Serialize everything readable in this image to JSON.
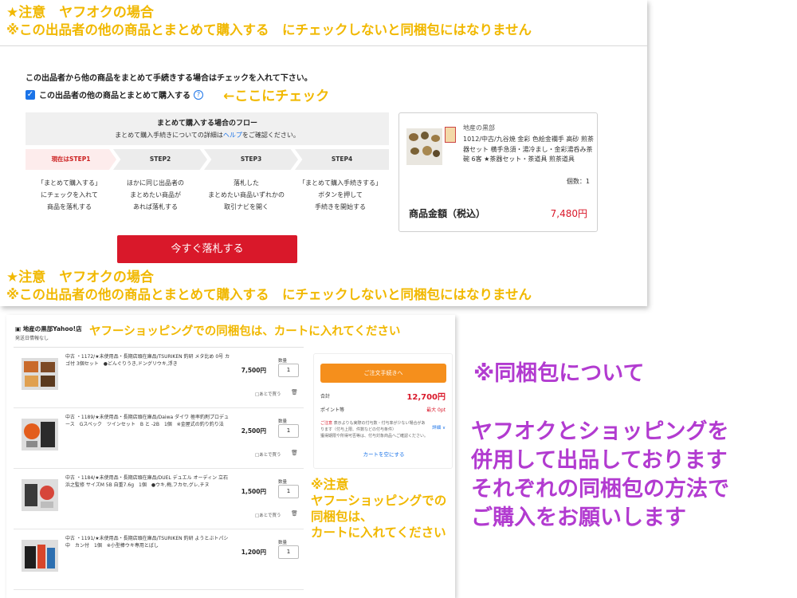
{
  "notice": {
    "line1": "★注意　ヤフオクの場合",
    "line2": "※この出品者の他の商品とまとめて購入する　にチェックしないと同梱包にはなりません"
  },
  "auction": {
    "instruction": "この出品者から他の商品をまとめて手続きする場合はチェックを入れて下さい。",
    "checkbox_label": "この出品者の他の商品とまとめて購入する",
    "help_glyph": "?",
    "arrow_annotation": "←ここにチェック",
    "flow_title": "まとめて購入する場合のフロー",
    "flow_sub_prefix": "まとめて購入手続きについての詳細は",
    "flow_sub_link": "ヘルプ",
    "flow_sub_suffix": "をご確認ください。",
    "steps": [
      "現在はSTEP1",
      "STEP2",
      "STEP3",
      "STEP4"
    ],
    "step_descriptions": [
      [
        "「まとめて購入する」",
        "にチェックを入れて",
        "商品を落札する"
      ],
      [
        "ほかに同じ出品者の",
        "まとめたい商品が",
        "あれば落札する"
      ],
      [
        "落札した",
        "まとめたい商品いずれかの",
        "取引ナビを開く"
      ],
      [
        "「まとめて購入手続きする」",
        "ボタンを押して",
        "手続きを開始する"
      ]
    ],
    "bid_button": "今すぐ落札する",
    "product": {
      "shop": "地産の黒部",
      "title": "1012/中古/九谷焼 金彩 色絵金襴手 高砂 煎茶器セット 横手急須・湯冷まし・金彩湯呑み茶碗 6客 ★茶器セット・茶道具 煎茶道具",
      "quantity": "個数：1",
      "total_label": "商品金額（税込）",
      "total_value": "7,480円"
    }
  },
  "shopping": {
    "store_name": "地産の黒部Yahoo!店",
    "store_sub": "発送日情報なし",
    "headline": "ヤフーショッピングでの同梱包は、カートに入れてください",
    "qty_label": "数量",
    "save_later": "あとで買う",
    "items": [
      {
        "title": "中古 ・1172/★未使用品・長期店頭在庫品/TSURIKEN 釣研 メタ比め 0号 カゴ付 3個セット　●どんぐりうき,ドングリウキ,浮き",
        "price": "7,500円",
        "qty": "1"
      },
      {
        "title": "中古 ・1189/★未使用品・長期店頭在庫品/Daiwa ダイワ 極率釣剤プロデュース　Gスペック　ツインセット　B と -2B　1個　※金屋式の釣り釣り法",
        "price": "2,500円",
        "qty": "1"
      },
      {
        "title": "中古 ・1184/★未使用品・長期店頭在庫品/DUEL デュエル オーディン 立石浜之監修 サイズM 5B 自重7.6g　1個　●ウキ,梅,フカセ,グレ,チヌ",
        "price": "1,500円",
        "qty": "1"
      },
      {
        "title": "中古 ・1191/★未使用品・長期店頭在庫品/TSURIKEN 釣研 ようとぶトパシ中　カン付　1個　※小型棒ウキ専用とばし",
        "price": "1,200円",
        "qty": "1"
      }
    ],
    "summary": {
      "order_button": "ご注文手続きへ",
      "total_label": "合計",
      "total_value": "12,700円",
      "points_label": "ポイント等",
      "points_value": "最大 0pt",
      "note_red": "ご注意",
      "note": "表示よりも実際の付与数・付与率が少ない場合があります（付与上限、件数などの付与条件）",
      "note2": "獲得期限や所得可否等は、付与対象商品へご確認ください。",
      "detail_link": "詳細 ∨",
      "empty_cart": "カートを空にする"
    },
    "ship_note": [
      "※注意",
      "ヤフーショッピングでの",
      "同梱包は、",
      "カートに入れてください"
    ]
  },
  "announcement": {
    "title": "※同梱包について",
    "body": [
      "ヤフオクとショッピングを",
      "併用して出品しております",
      "それぞれの同梱包の方法で",
      "ご購入をお願いします"
    ]
  },
  "colors": {
    "notice_yellow": "#f1b800",
    "purple": "#b23bd0",
    "bid_red": "#d9182a",
    "order_orange": "#f58f1c",
    "link_blue": "#1a73e8"
  },
  "icons": {
    "checkbox": "checkbox-checked-icon",
    "help": "help-circle-icon",
    "trash": "trash-icon",
    "store": "store-icon"
  }
}
